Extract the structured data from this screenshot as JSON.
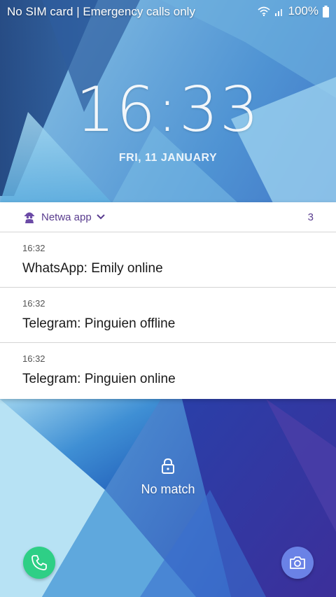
{
  "status_bar": {
    "carrier_text": "No SIM card | Emergency calls only",
    "battery": "100%",
    "icons": [
      "wifi-icon",
      "signal-icon",
      "battery-icon"
    ]
  },
  "lockscreen": {
    "time": "16:33",
    "date": "FRI, 11 JANUARY"
  },
  "notification_group": {
    "app_name": "Netwa app",
    "count": "3",
    "accent_color": "#5a3d8f",
    "items": [
      {
        "time": "16:32",
        "text": "WhatsApp: Emily online"
      },
      {
        "time": "16:32",
        "text": "Telegram: Pinguien offline"
      },
      {
        "time": "16:32",
        "text": "Telegram: Pinguien online"
      }
    ]
  },
  "unlock": {
    "status_text": "No match",
    "icon": "lock-icon"
  },
  "shortcuts": {
    "left": {
      "icon": "phone-icon",
      "color": "#2ecf86"
    },
    "right": {
      "icon": "camera-icon",
      "color": "#6a82e6"
    }
  }
}
